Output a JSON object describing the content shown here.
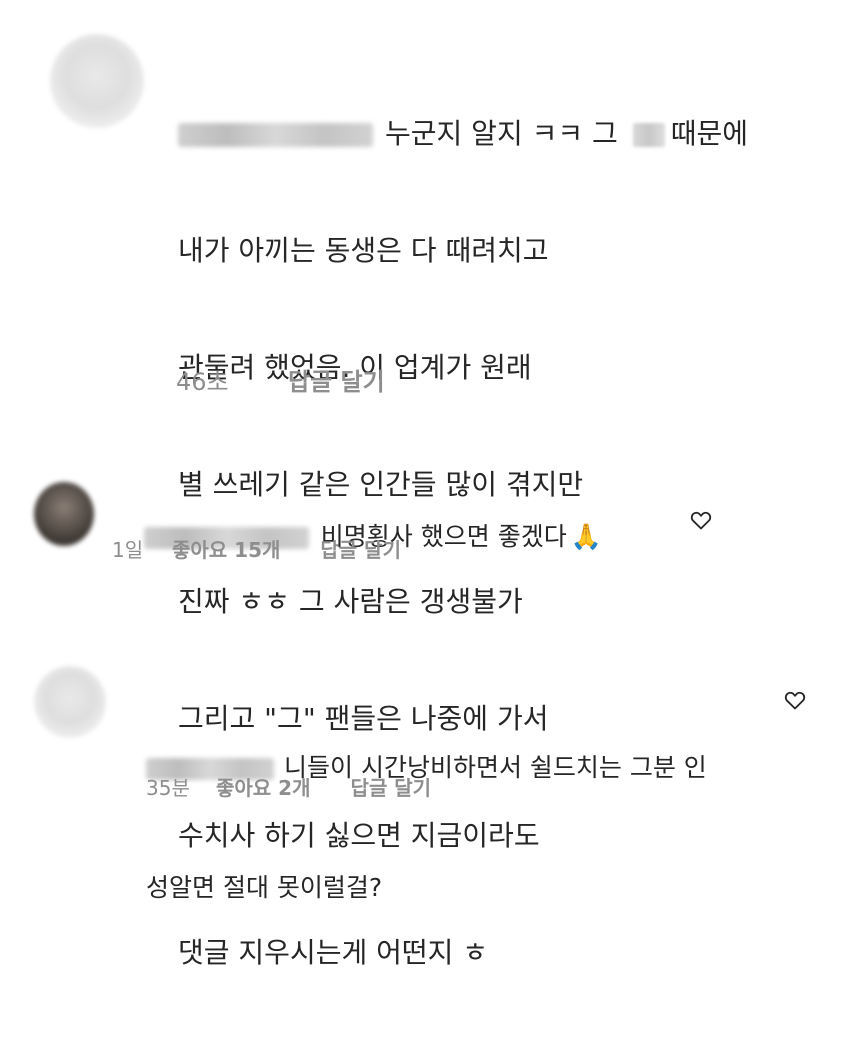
{
  "comments": [
    {
      "lines": [
        "누군지 알지 ㅋㅋ 그",
        "때문에",
        "내가 아끼는 동생은 다 때려치고",
        "관둘려 했었음. 이 업계가 원래",
        "별 쓰레기 같은 인간들 많이 겪지만",
        "진짜 ㅎㅎ 그 사람은 갱생불가",
        "그리고 \"그\" 팬들은 나중에 가서",
        "수치사 하기 싫으면 지금이라도",
        "댓글 지우시는게 어떤지 ㅎ"
      ],
      "time": "46초",
      "reply": "답글 달기"
    },
    {
      "text": "비명횡사 했으면 좋겠다",
      "emoji": "🙏",
      "time": "1일",
      "likes": "좋아요 15개",
      "reply": "답글 달기",
      "like_icon": "heart-icon"
    },
    {
      "lines": [
        "니들이 시간낭비하면서 쉴드치는 그분 인",
        "성알면 절대 못이럴걸?"
      ],
      "time": "35분",
      "likes": "좋아요 2개",
      "reply": "답글 달기",
      "like_icon": "heart-icon"
    }
  ]
}
